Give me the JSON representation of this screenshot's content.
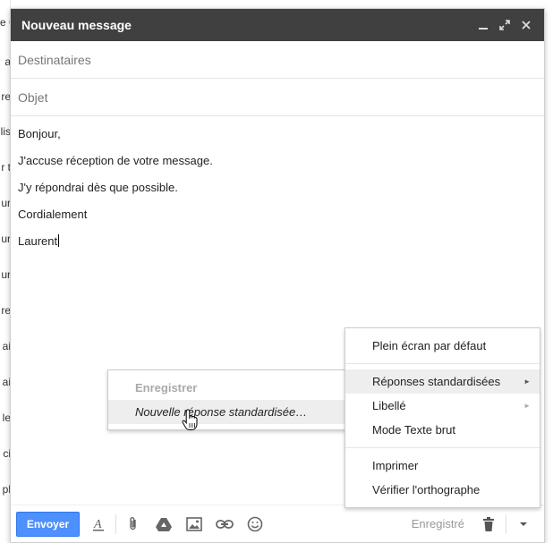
{
  "background": {
    "fragments": [
      "e C",
      "a",
      "re",
      "lis",
      "r t",
      "ur",
      "ur",
      "ur",
      "re",
      "ai",
      "ai",
      "le",
      "ci",
      "pl"
    ]
  },
  "compose": {
    "title": "Nouveau message",
    "controls": {
      "minimize": "minimize-icon",
      "expand": "expand-icon",
      "close": "close-icon"
    },
    "recipients_placeholder": "Destinataires",
    "subject_placeholder": "Objet",
    "body_lines": [
      "Bonjour,",
      "J'accuse réception de votre message.",
      "J'y répondrai dès que possible.",
      "Cordialement",
      "Laurent"
    ]
  },
  "toolbar": {
    "send_label": "Envoyer",
    "saved_label": "Enregistré",
    "icons": [
      "format-text-icon",
      "attach-icon",
      "drive-icon",
      "insert-photo-icon",
      "link-icon",
      "emoji-icon",
      "trash-icon",
      "more-options-icon"
    ]
  },
  "submenu": {
    "items": [
      {
        "label": "Enregistrer",
        "disabled": true
      },
      {
        "label": "Nouvelle réponse standardisée…",
        "hover": true
      }
    ]
  },
  "options_menu": {
    "items": [
      {
        "label": "Plein écran par défaut"
      },
      {
        "label": "Réponses standardisées",
        "arrow": "►",
        "hover": true
      },
      {
        "label": "Libellé",
        "arrow": "►"
      },
      {
        "label": "Mode Texte brut"
      },
      {
        "label": "Imprimer"
      },
      {
        "label": "Vérifier l'orthographe"
      }
    ]
  },
  "colors": {
    "titlebar": "#404040",
    "send_button": "#4d90fe",
    "hover": "#eeeeee"
  }
}
